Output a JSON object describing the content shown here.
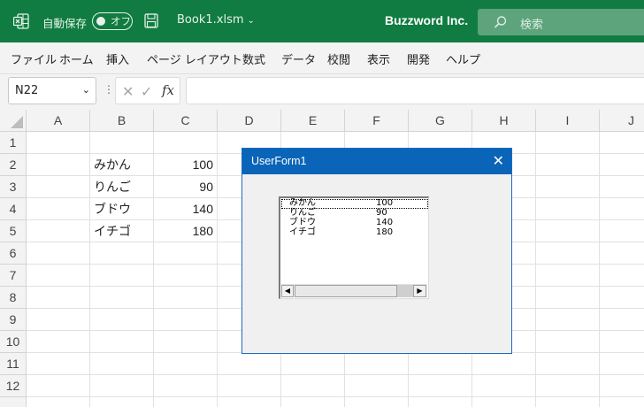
{
  "titlebar": {
    "autosave_label": "自動保存",
    "autosave_state": "オフ",
    "filename": "Book1.xlsm",
    "company": "Buzzword Inc.",
    "search_placeholder": "検索",
    "bg_color": "#107c41"
  },
  "menu": [
    "ファイル",
    "ホーム",
    "挿入",
    "ページ レイアウト",
    "数式",
    "データ",
    "校閲",
    "表示",
    "開発",
    "ヘルプ"
  ],
  "formula_bar": {
    "name_box": "N22",
    "formula": ""
  },
  "grid": {
    "columns": [
      "A",
      "B",
      "C",
      "D",
      "E",
      "F",
      "G",
      "H",
      "I",
      "J"
    ],
    "rows": [
      "1",
      "2",
      "3",
      "4",
      "5",
      "6",
      "7",
      "8",
      "9",
      "10",
      "11",
      "12"
    ],
    "data": [
      {
        "name": "みかん",
        "value": "100"
      },
      {
        "name": "りんご",
        "value": "90"
      },
      {
        "name": "ブドウ",
        "value": "140"
      },
      {
        "name": "イチゴ",
        "value": "180"
      }
    ]
  },
  "userform": {
    "title": "UserForm1",
    "list_items": [
      {
        "name": "みかん",
        "value": "100"
      },
      {
        "name": "りんご",
        "value": "90"
      },
      {
        "name": "ブドウ",
        "value": "140"
      },
      {
        "name": "イチゴ",
        "value": "180"
      }
    ]
  }
}
